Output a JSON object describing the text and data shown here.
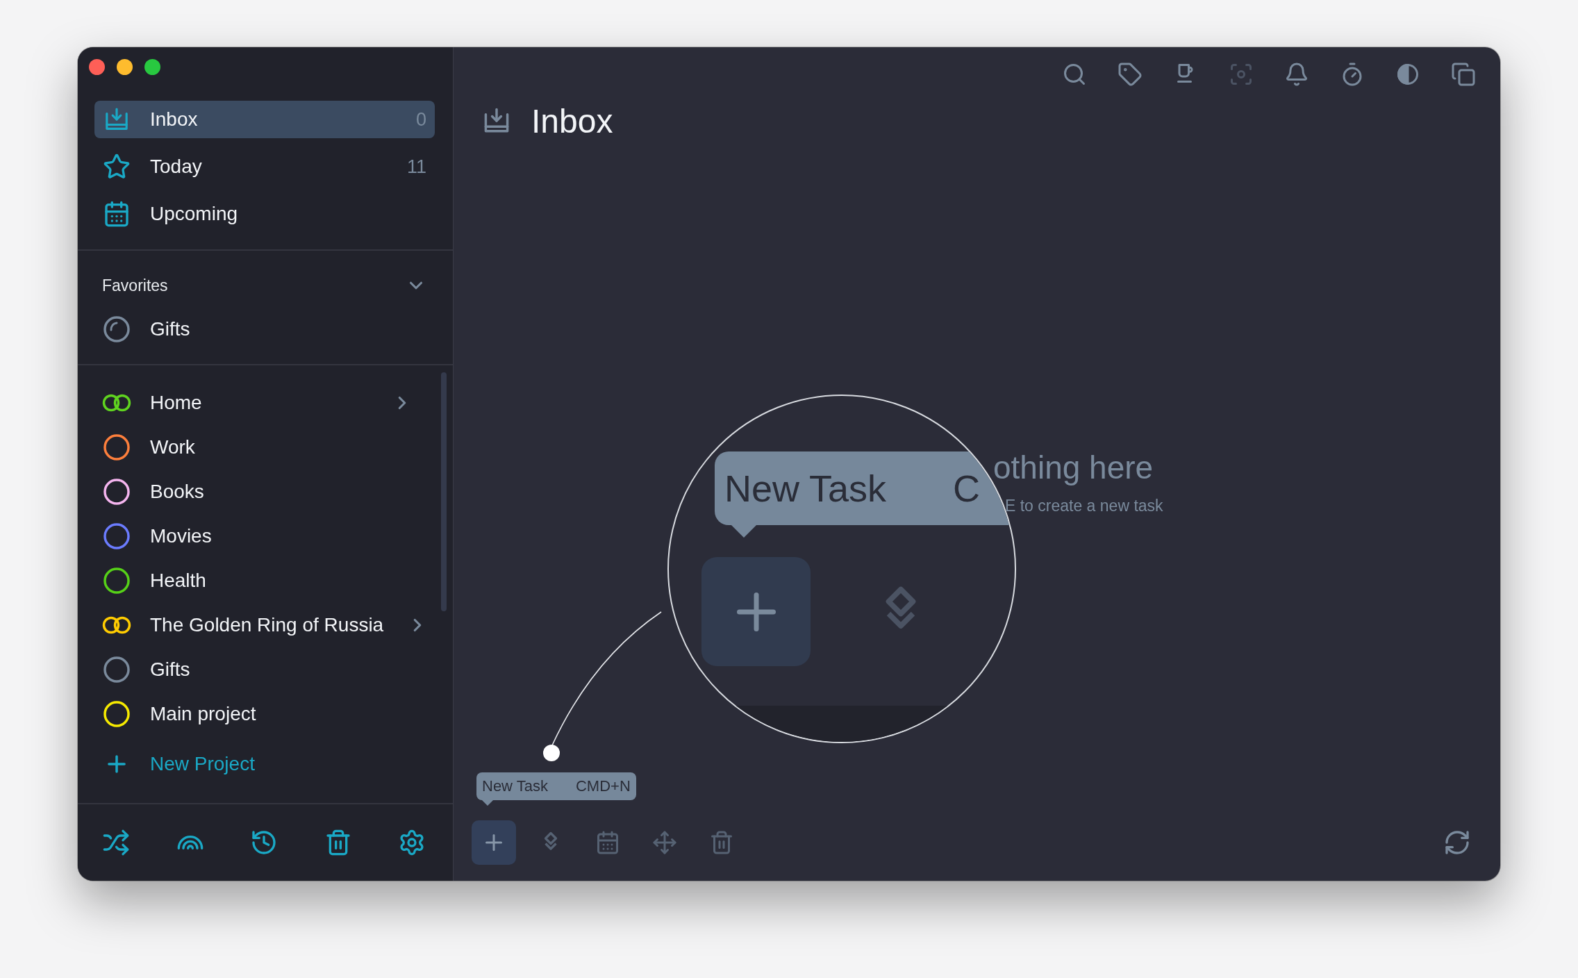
{
  "sidebar": {
    "nav": [
      {
        "label": "Inbox",
        "count": "0",
        "selected": true
      },
      {
        "label": "Today",
        "count": "11",
        "selected": false
      },
      {
        "label": "Upcoming",
        "selected": false
      }
    ],
    "favorites": {
      "title": "Favorites",
      "expanded": true,
      "items": [
        {
          "label": "Gifts",
          "color": "#7a8a9c"
        }
      ]
    },
    "projects": [
      {
        "label": "Home",
        "kind": "area",
        "color": "#5fd31f"
      },
      {
        "label": "Work",
        "kind": "project",
        "color": "#fd7f3c"
      },
      {
        "label": "Books",
        "kind": "project",
        "color": "#f5b5ef"
      },
      {
        "label": "Movies",
        "kind": "project",
        "color": "#6b7cff"
      },
      {
        "label": "Health",
        "kind": "project",
        "color": "#56d118"
      },
      {
        "label": "The Golden Ring of Russia",
        "kind": "area",
        "color": "#ffcc00"
      },
      {
        "label": "Gifts",
        "kind": "project",
        "color": "#7a8a9c"
      },
      {
        "label": "Main project",
        "kind": "project",
        "color": "#f6ea00"
      }
    ],
    "new_project": "New Project"
  },
  "main": {
    "title": "Inbox",
    "top_toolbar": [
      {
        "disabled": false
      },
      {
        "disabled": false
      },
      {
        "disabled": false
      },
      {
        "disabled": true
      },
      {
        "disabled": false
      },
      {
        "disabled": false
      },
      {
        "disabled": false
      },
      {
        "disabled": false
      }
    ],
    "empty_state": {
      "heading": "othing here",
      "hint": "E to create a new task"
    },
    "magnifier": {
      "tooltip_label": "New Task",
      "tooltip_shortcut": "C"
    },
    "tooltip": {
      "label": "New Task",
      "shortcut": "CMD+N"
    },
    "bottom_toolbar": [
      {
        "highlighted": true,
        "disabled": false
      },
      {
        "highlighted": false,
        "disabled": true
      },
      {
        "highlighted": false,
        "disabled": true
      },
      {
        "highlighted": false,
        "disabled": true
      },
      {
        "highlighted": false,
        "disabled": true
      }
    ]
  }
}
